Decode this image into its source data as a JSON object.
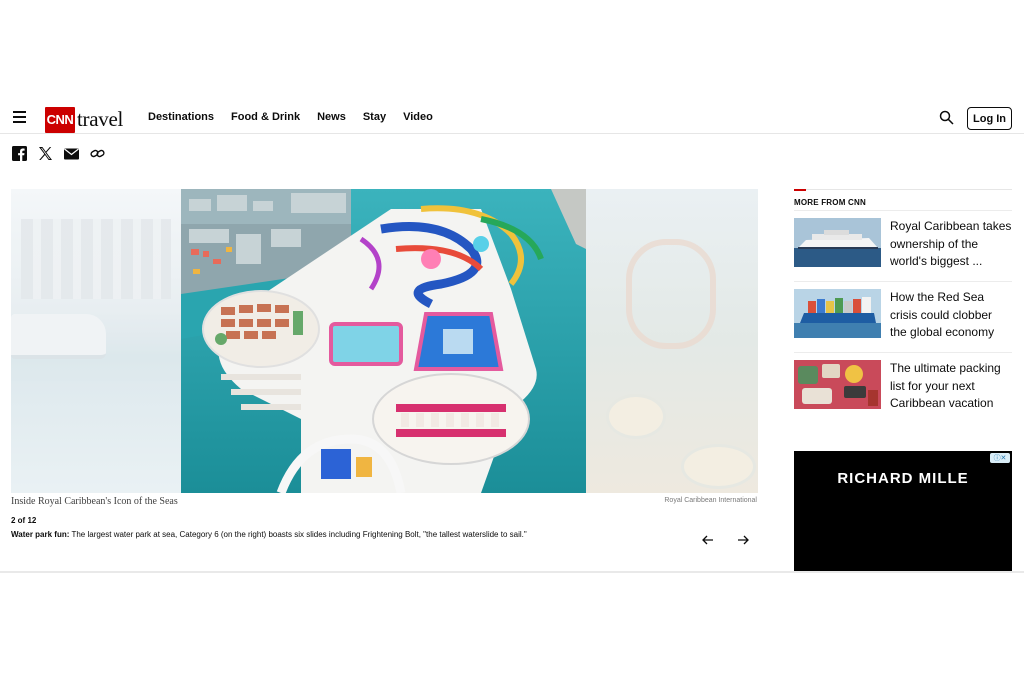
{
  "header": {
    "logo_box": "CNN",
    "logo_text": "travel",
    "nav": [
      "Destinations",
      "Food & Drink",
      "News",
      "Stay",
      "Video"
    ],
    "login_label": "Log In"
  },
  "gallery": {
    "title": "Inside Royal Caribbean's Icon of the Seas",
    "credit": "Royal Caribbean International",
    "counter": "2 of 12",
    "caption_lead": "Water park fun:",
    "caption_body": "The largest water park at sea, Category 6 (on the right) boasts six slides including Frightening Bolt, \"the tallest waterslide to sail.\""
  },
  "sidebar": {
    "heading": "MORE FROM CNN",
    "cards": [
      {
        "title": "Royal Caribbean takes ownership of the world's biggest ..."
      },
      {
        "title": "How the Red Sea crisis could clobber the global economy"
      },
      {
        "title": "The ultimate packing list for your next Caribbean vacation"
      }
    ]
  },
  "ad": {
    "brand": "RICHARD MILLE"
  },
  "colors": {
    "brand_red": "#cc0000",
    "text": "#0c0c0c",
    "water": "#1e9aa3"
  }
}
